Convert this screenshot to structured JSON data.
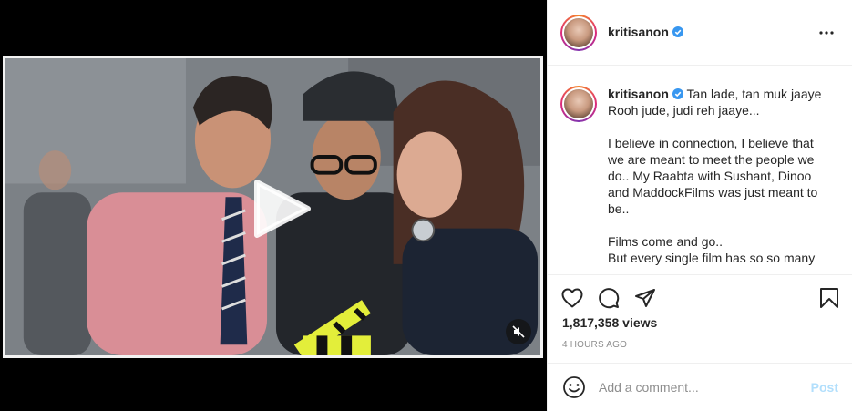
{
  "post": {
    "username": "kritisanon",
    "verified": true,
    "more_icon": "more-horizontal-icon"
  },
  "caption": {
    "username": "kritisanon",
    "lines": [
      "Tan lade, tan muk jaaye",
      "Rooh jude, judi reh jaaye...",
      "",
      "I believe in connection, I believe that",
      "we are meant to meet the people we",
      "do.. My Raabta with Sushant, Dinoo",
      "and MaddockFilms was just meant to",
      "be..",
      "",
      "Films come and go..",
      "But every single film has so so many"
    ]
  },
  "actions": {
    "like_icon": "heart-icon",
    "comment_icon": "comment-icon",
    "share_icon": "paper-plane-icon",
    "save_icon": "bookmark-icon"
  },
  "stats": {
    "views": "1,817,358 views",
    "timestamp": "4 HOURS AGO"
  },
  "comment": {
    "emoji_icon": "smiley-icon",
    "placeholder": "Add a comment...",
    "post_label": "Post"
  },
  "media": {
    "type": "video",
    "play_icon": "play-icon",
    "mute_icon": "speaker-muted-icon"
  },
  "colors": {
    "verified_blue": "#3897f0",
    "post_disabled": "#b2dffc",
    "muted_text": "#8e8e8e"
  }
}
